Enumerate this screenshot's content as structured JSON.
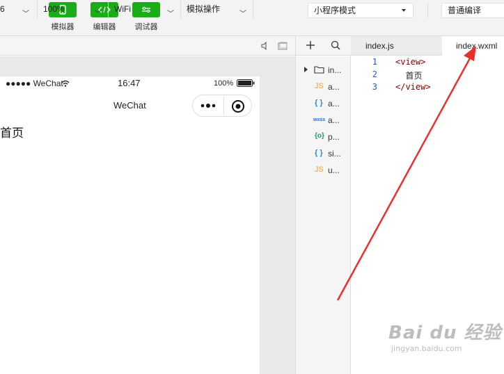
{
  "toolbar": {
    "simulator_label": "模拟器",
    "editor_label": "编辑器",
    "debugger_label": "调试器",
    "mode_select": "小程序模式",
    "compile_select": "普通编译"
  },
  "simulator_bar": {
    "device_partial": "6",
    "zoom": "100%",
    "network": "WiFi",
    "actions": "模拟操作"
  },
  "phone": {
    "carrier": "●●●●● WeChat",
    "time": "16:47",
    "battery": "100%",
    "nav_title": "WeChat",
    "page_text": "首页"
  },
  "file_tree": {
    "items": [
      {
        "icon": "folder",
        "name": "in..."
      },
      {
        "icon": "JS",
        "name": "a..."
      },
      {
        "icon": "{ }",
        "name": "a..."
      },
      {
        "icon": "wxss",
        "name": "a..."
      },
      {
        "icon": "{o}",
        "name": "p..."
      },
      {
        "icon": "{ }",
        "name": "si..."
      },
      {
        "icon": "JS",
        "name": "u..."
      }
    ]
  },
  "editor": {
    "tabs": [
      "index.js",
      "index.wxml"
    ],
    "active_tab": "index.wxml",
    "lines": [
      {
        "num": "1",
        "text": "<view>"
      },
      {
        "num": "2",
        "text": "  首页"
      },
      {
        "num": "3",
        "text": "</view>"
      }
    ]
  },
  "watermark": {
    "main": "Bai du 经验",
    "url": "jingyan.baidu.com"
  },
  "colors": {
    "accent_green": "#1aad19",
    "annotation_red": "#e8302c"
  }
}
